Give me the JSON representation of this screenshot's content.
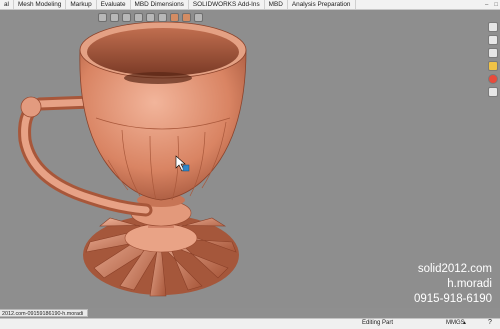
{
  "ribbon": {
    "tabs": [
      "al",
      "Mesh Modeling",
      "Markup",
      "Evaluate",
      "MBD Dimensions",
      "SOLIDWORKS Add-Ins",
      "MBD",
      "Analysis Preparation"
    ]
  },
  "watermark": {
    "line1": "solid2012.com",
    "line2": "h.moradi",
    "line3": "0915-918-6190"
  },
  "file_tab": {
    "label": "2012.com-09159186190-h.moradi"
  },
  "status_bar": {
    "mode": "Editing Part",
    "units": "MMGS",
    "units_arrow": "▲",
    "help": "?"
  },
  "colors": {
    "viewport": "#8e8e8e",
    "model": "#d4876a",
    "watermark_text": "#ffffff"
  },
  "icons": [
    "zoom-icon",
    "view-orientation-icon",
    "display-style-icon",
    "appearance-icon",
    "scene-icon",
    "cursor-pointer-icon"
  ]
}
